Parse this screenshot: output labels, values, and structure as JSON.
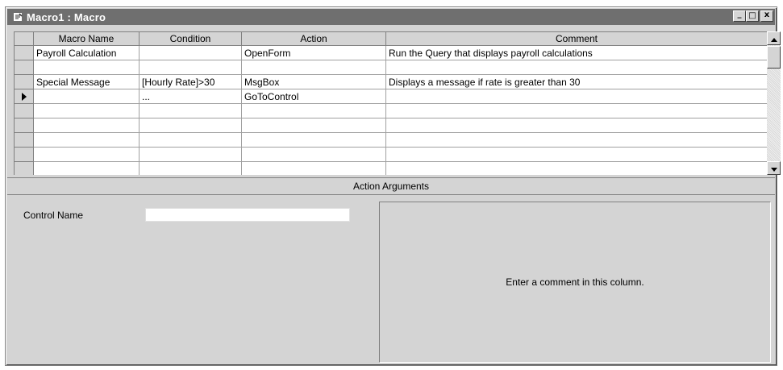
{
  "window": {
    "title": "Macro1 : Macro",
    "buttons": {
      "minimize": "_",
      "maximize": "□",
      "close": "x"
    }
  },
  "grid": {
    "columns": [
      "Macro Name",
      "Condition",
      "Action",
      "Comment"
    ],
    "rows": [
      {
        "macro_name": "Payroll Calculation",
        "condition": "",
        "action": "OpenForm",
        "comment": "Run the Query that displays payroll calculations",
        "current": false
      },
      {
        "macro_name": "",
        "condition": "",
        "action": "",
        "comment": "",
        "current": false
      },
      {
        "macro_name": "Special Message",
        "condition": "[Hourly Rate]>30",
        "action": "MsgBox",
        "comment": "Displays a message if rate is greater than 30",
        "current": false
      },
      {
        "macro_name": "",
        "condition": "...",
        "action": "GoToControl",
        "comment": "",
        "current": true
      },
      {
        "macro_name": "",
        "condition": "",
        "action": "",
        "comment": "",
        "current": false
      },
      {
        "macro_name": "",
        "condition": "",
        "action": "",
        "comment": "",
        "current": false
      },
      {
        "macro_name": "",
        "condition": "",
        "action": "",
        "comment": "",
        "current": false
      },
      {
        "macro_name": "",
        "condition": "",
        "action": "",
        "comment": "",
        "current": false
      },
      {
        "macro_name": "",
        "condition": "",
        "action": "",
        "comment": "",
        "current": false
      }
    ]
  },
  "action_arguments": {
    "header": "Action Arguments",
    "control_name_label": "Control Name",
    "control_name_value": "",
    "help_text": "Enter a comment in this column."
  },
  "icons": {
    "title_icon": "macro-icon",
    "row_pointer": "row-pointer-icon",
    "scroll_up": "scroll-up-arrow-icon",
    "scroll_down": "scroll-down-arrow-icon"
  }
}
